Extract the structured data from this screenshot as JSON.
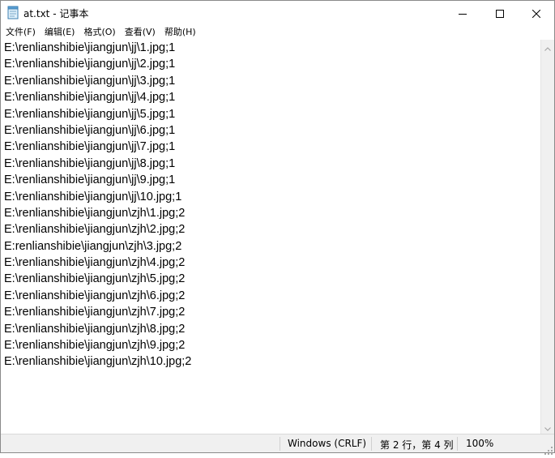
{
  "window": {
    "title": "at.txt - 记事本"
  },
  "menu": [
    {
      "label": "文件(F)"
    },
    {
      "label": "编辑(E)"
    },
    {
      "label": "格式(O)"
    },
    {
      "label": "查看(V)"
    },
    {
      "label": "帮助(H)"
    }
  ],
  "lines": [
    "E:\\renlianshibie\\jiangjun\\jj\\1.jpg;1",
    "E:\\renlianshibie\\jiangjun\\jj\\2.jpg;1",
    "E:\\renlianshibie\\jiangjun\\jj\\3.jpg;1",
    "E:\\renlianshibie\\jiangjun\\jj\\4.jpg;1",
    "E:\\renlianshibie\\jiangjun\\jj\\5.jpg;1",
    "E:\\renlianshibie\\jiangjun\\jj\\6.jpg;1",
    "E:\\renlianshibie\\jiangjun\\jj\\7.jpg;1",
    "E:\\renlianshibie\\jiangjun\\jj\\8.jpg;1",
    "E:\\renlianshibie\\jiangjun\\jj\\9.jpg;1",
    "E:\\renlianshibie\\jiangjun\\jj\\10.jpg;1",
    "E:\\renlianshibie\\jiangjun\\zjh\\1.jpg;2",
    "E:\\renlianshibie\\jiangjun\\zjh\\2.jpg;2",
    "E:renlianshibie\\jiangjun\\zjh\\3.jpg;2",
    "E:\\renlianshibie\\jiangjun\\zjh\\4.jpg;2",
    "E:\\renlianshibie\\jiangjun\\zjh\\5.jpg;2",
    "E:\\renlianshibie\\jiangjun\\zjh\\6.jpg;2",
    "E:\\renlianshibie\\jiangjun\\zjh\\7.jpg;2",
    "E:\\renlianshibie\\jiangjun\\zjh\\8.jpg;2",
    "E:\\renlianshibie\\jiangjun\\zjh\\9.jpg;2",
    "E:\\renlianshibie\\jiangjun\\zjh\\10.jpg;2"
  ],
  "status": {
    "encoding": "Windows (CRLF)",
    "position": "第 2 行，第 4 列",
    "zoom": "100%"
  },
  "icons": {
    "app": "notepad-icon",
    "minimize": "minimize-icon",
    "maximize": "maximize-icon",
    "close": "close-icon",
    "scroll_up": "chevron-up-icon",
    "scroll_down": "chevron-down-icon",
    "grip": "resize-grip-icon"
  }
}
